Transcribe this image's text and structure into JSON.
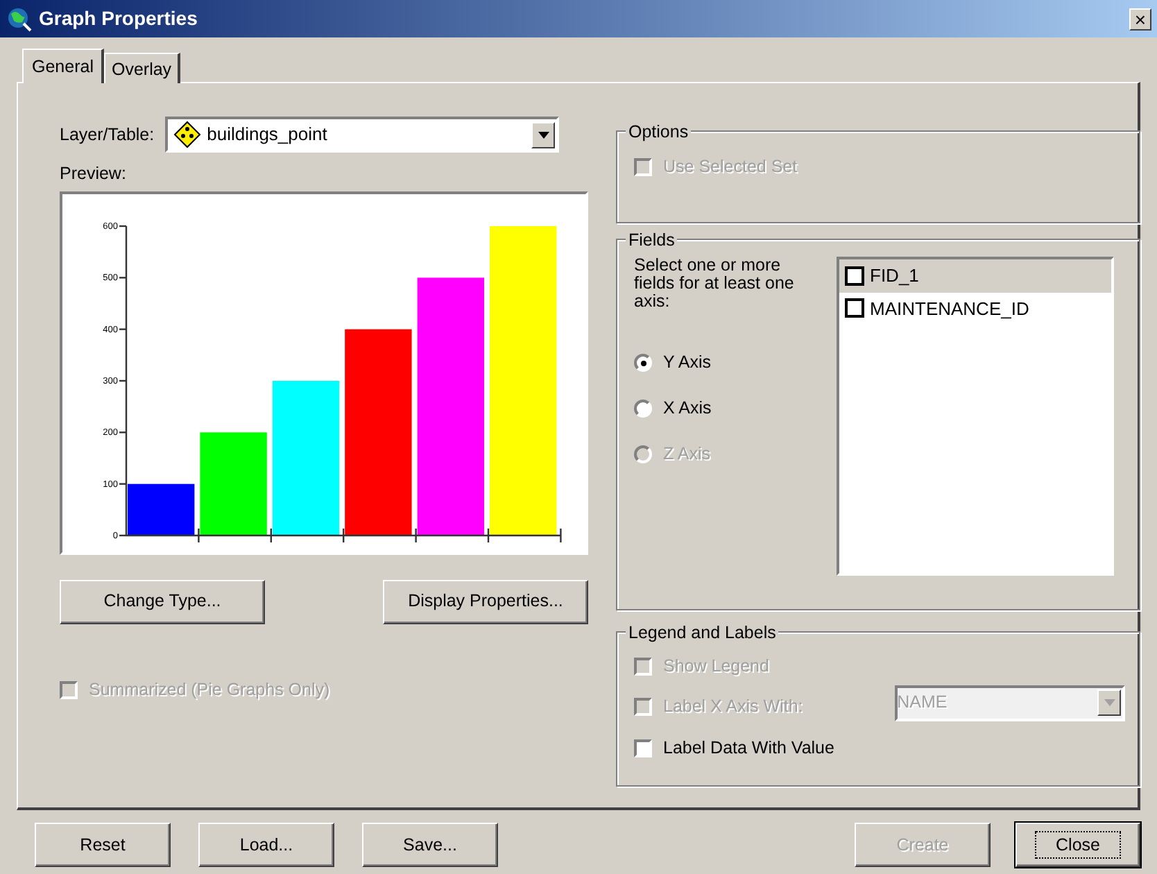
{
  "window": {
    "title": "Graph Properties",
    "close": "×"
  },
  "tabs": [
    {
      "label": "General",
      "selected": true
    },
    {
      "label": "Overlay",
      "selected": false
    }
  ],
  "layer_table": {
    "label": "Layer/Table:",
    "value": "buildings_point"
  },
  "preview": {
    "label": "Preview:",
    "chart_data": {
      "type": "bar",
      "ylim": [
        0,
        600
      ],
      "yticks": [
        0,
        100,
        200,
        300,
        400,
        500,
        600
      ],
      "series": [
        {
          "color": "#0000ff",
          "values": [
            100,
            null,
            null,
            null,
            null,
            null
          ]
        },
        {
          "color": "#00ff00",
          "values": [
            null,
            200,
            null,
            null,
            null,
            null
          ]
        },
        {
          "color": "#00ffff",
          "values": [
            null,
            null,
            300,
            null,
            null,
            null
          ]
        },
        {
          "color": "#ff0000",
          "values": [
            null,
            null,
            null,
            400,
            null,
            null
          ]
        },
        {
          "color": "#ff00ff",
          "values": [
            null,
            null,
            null,
            null,
            500,
            null
          ]
        },
        {
          "color": "#ffff00",
          "values": [
            null,
            null,
            null,
            null,
            null,
            600
          ]
        }
      ]
    }
  },
  "chart_buttons": [
    {
      "label": "Change Type..."
    },
    {
      "label": "Display Properties..."
    }
  ],
  "summarized": {
    "label": "Summarized (Pie Graphs Only)",
    "checked": false,
    "disabled": true
  },
  "options": {
    "title": "Options",
    "use_selected_set": {
      "label": "Use Selected Set",
      "checked": false,
      "disabled": true
    }
  },
  "fields": {
    "title": "Fields",
    "instruction": "Select one or more fields for at least one axis:",
    "axes": [
      {
        "label": "Y Axis",
        "selected": true,
        "disabled": false
      },
      {
        "label": "X Axis",
        "selected": false,
        "disabled": false
      },
      {
        "label": "Z Axis",
        "selected": false,
        "disabled": true
      }
    ],
    "field_list": [
      {
        "label": "FID_1",
        "checked": false,
        "selected": true
      },
      {
        "label": "MAINTENANCE_ID",
        "checked": false,
        "selected": false
      }
    ]
  },
  "legend_labels": {
    "title": "Legend and Labels",
    "items": [
      {
        "kind": "checkbox",
        "label": "Show Legend",
        "checked": false,
        "disabled": true
      },
      {
        "kind": "checkbox_combo",
        "label": "Label X Axis With:",
        "checked": false,
        "disabled": true,
        "value": "NAME"
      },
      {
        "kind": "checkbox",
        "label": "Label Data With Value",
        "checked": false,
        "disabled": false
      }
    ]
  },
  "footer_buttons": [
    {
      "label": "Reset",
      "disabled": false,
      "default": false
    },
    {
      "label": "Load...",
      "disabled": false,
      "default": false
    },
    {
      "label": "Save...",
      "disabled": false,
      "default": false
    },
    {
      "label": "Create",
      "disabled": true,
      "default": false
    },
    {
      "label": "Close",
      "disabled": false,
      "default": true
    }
  ]
}
